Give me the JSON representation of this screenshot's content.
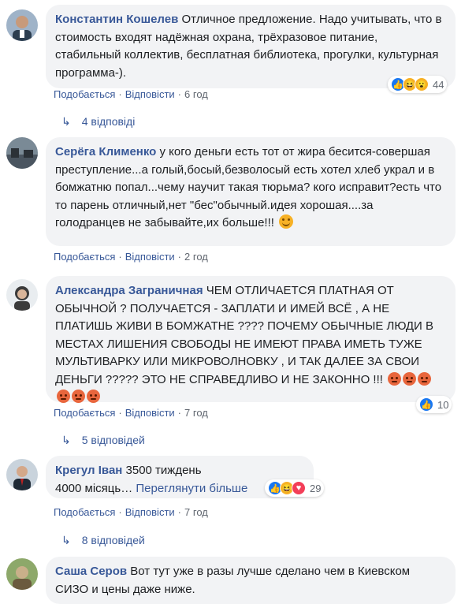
{
  "comments": [
    {
      "author": "Константин Кошелев",
      "text": "Отличное предложение. Надо учитывать, что в стоимость входят надёжная охрана, трёхразовое питание, стабильный коллектив, бесплатная библиотека, прогулки, культурная программа-).",
      "like_label": "Подобається",
      "reply_label": "Відповісти",
      "time": "6 год",
      "reactions_count": "44",
      "replies_label": "4 відповіді"
    },
    {
      "author": "Серёга Клименко",
      "text": "у кого деньги есть тот от жира бесится-совершая преступление...а голый,босый,безволосый есть хотел хлеб украл и в бомжатню попал...чему научит такая тюрьма? кого исправит?есть что то парень отличный,нет \"бес\"обычный.идея хорошая....за голодранцев не забывайте,их больше!!!",
      "like_label": "Подобається",
      "reply_label": "Відповісти",
      "time": "2 год"
    },
    {
      "author": "Александра Заграничная",
      "text": "ЧЕМ ОТЛИЧАЕТСЯ ПЛАТНАЯ ОТ ОБЫЧНОЙ ? ПОЛУЧАЕТСЯ - ЗАПЛАТИ И ИМЕЙ ВСЁ , А НЕ ПЛАТИШЬ ЖИВИ В БОМЖАТНЕ ???? ПОЧЕМУ ОБЫЧНЫЕ ЛЮДИ В МЕСТАХ ЛИШЕНИЯ СВОБОДЫ НЕ ИМЕЮТ ПРАВА ИМЕТЬ ТУЖЕ МУЛЬТИВАРКУ ИЛИ МИКРОВОЛНОВКУ , И ТАК ДАЛЕЕ ЗА СВОИ ДЕНЬГИ ????? ЭТО НЕ СПРАВЕДЛИВО И НЕ ЗАКОННО !!!",
      "like_label": "Подобається",
      "reply_label": "Відповісти",
      "time": "7 год",
      "reactions_count": "10",
      "replies_label": "5 відповідей"
    },
    {
      "author": "Крегул Іван",
      "text_line1": "3500 тиждень",
      "text_line2": "4000 місяць…",
      "see_more": "Переглянути більше",
      "like_label": "Подобається",
      "reply_label": "Відповісти",
      "time": "7 год",
      "reactions_count": "29",
      "replies_label": "8 відповідей"
    },
    {
      "author": "Саша Серов",
      "text": "Вот тут уже в разы лучше сделано чем в Киевском СИЗО и цены даже ниже."
    }
  ],
  "colors": {
    "link": "#385898",
    "bubble": "#f2f3f5",
    "meta": "#616770",
    "like_reaction": "#1877f2",
    "haha_reaction": "#f7b125",
    "love_reaction": "#f33e58"
  }
}
